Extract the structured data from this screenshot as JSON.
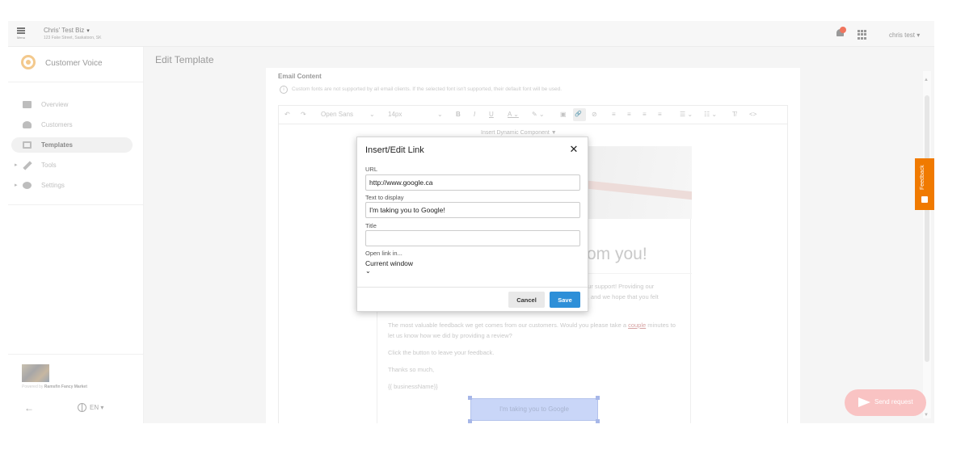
{
  "topbar": {
    "menu_label": "Menu",
    "business_name": "Chris' Test Biz",
    "business_address": "123 Fake Street, Saskatoon, SK",
    "user_name": "chris test",
    "user_caret": "▾",
    "business_caret": "▾"
  },
  "sidebar": {
    "brand": "Customer Voice",
    "items": [
      {
        "label": "Overview",
        "icon": "overview-icon",
        "active": false
      },
      {
        "label": "Customers",
        "icon": "customers-icon",
        "active": false
      },
      {
        "label": "Templates",
        "icon": "templates-icon",
        "active": true
      },
      {
        "label": "Tools",
        "icon": "wrench-icon",
        "active": false,
        "expandable": true
      },
      {
        "label": "Settings",
        "icon": "gear-icon",
        "active": false,
        "expandable": true
      }
    ],
    "powered_prefix": "Powered by",
    "powered_by": "Ramsfin Fancy Market",
    "language": "EN ▾",
    "back_arrow": "←",
    "expand_arrow": "▸"
  },
  "main": {
    "page_title": "Edit Template",
    "section_title": "Email Content",
    "info_icon": "i",
    "info_text": "Custom fonts are not supported by all email clients. If the selected font isn't supported, their default font will be used.",
    "toolbar": {
      "undo": "↶",
      "redo": "↷",
      "font_family": "Open Sans",
      "font_family_caret": "⌄",
      "font_size": "14px",
      "font_size_caret": "⌄",
      "bold": "B",
      "italic": "I",
      "underline": "U",
      "text_color": "A ⌄",
      "highlight": "✎ ⌄",
      "image": "▣",
      "link": "🔗",
      "unlink": "⊘",
      "align_left": "≡",
      "align_center": "≡",
      "align_right": "≡",
      "align_justify": "≡",
      "bullet_list": "☰ ⌄",
      "number_list": "☷ ⌄",
      "clear_format": "T̸",
      "source_code": "<>"
    },
    "insert_dynamic": "Insert Dynamic Component ▼",
    "email": {
      "heading_fragment": "rom you!",
      "para1_right_line1": "our support! Providing our",
      "para1_right_line2": "s, and we hope that you felt",
      "para2_before": "The most valuable feedback we get comes from our customers. Would you please take a ",
      "para2_link": "couple",
      "para2_after": " minutes to let us know how we did by providing a review?",
      "para3": "Click the button to leave your feedback.",
      "para4": "Thanks so much,",
      "para5": "{{ businessName}}",
      "button_text": "I'm taking you to Google"
    },
    "scroll_up": "▲",
    "scroll_down": "▼"
  },
  "feedback_tab": {
    "label": "Feedback"
  },
  "send_request": {
    "label": "Send request"
  },
  "dialog": {
    "title": "Insert/Edit Link",
    "close": "✕",
    "url_label": "URL",
    "url_value": "http://www.google.ca",
    "text_label": "Text to display",
    "text_value": "I'm taking you to Google!",
    "title_label": "Title",
    "title_value": "",
    "open_label": "Open link in...",
    "open_value": "Current window",
    "open_chevron": "⌄",
    "cancel": "Cancel",
    "save": "Save"
  },
  "colors": {
    "save_button": "#2d8fd8",
    "feedback_tab": "#f07a00",
    "send_request": "#f9c3c3",
    "brand_accent": "#f3c98d"
  }
}
